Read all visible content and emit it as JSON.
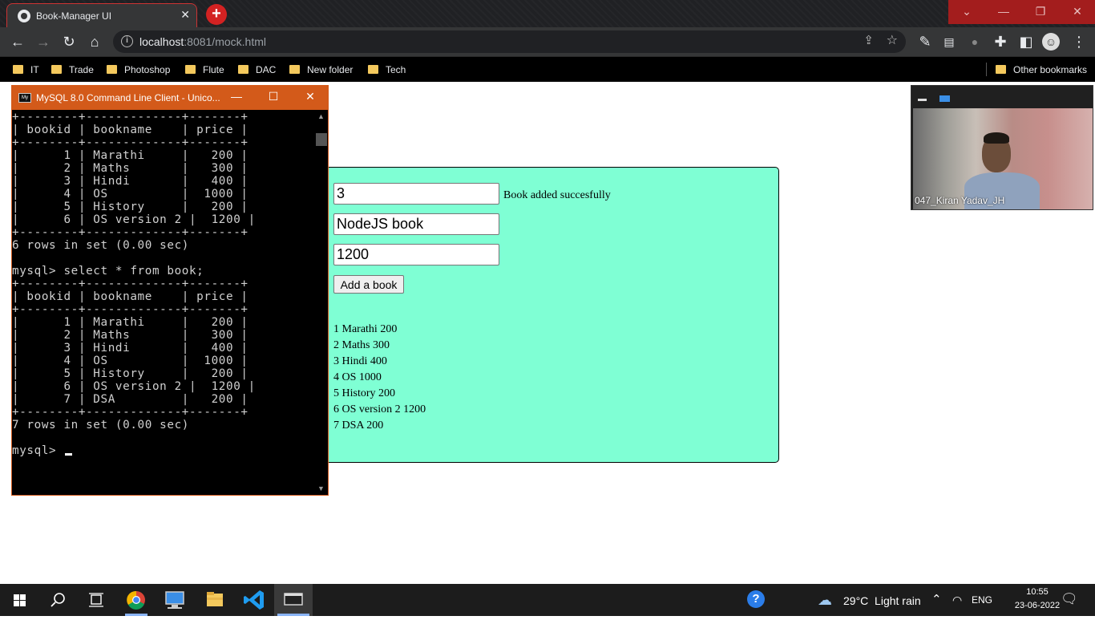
{
  "browser": {
    "tab_title": "Book-Manager UI",
    "url_host": "localhost",
    "url_rest": ":8081/mock.html",
    "bookmarks": [
      "IT",
      "Trade",
      "Photoshop",
      "Flute",
      "DAC",
      "New folder",
      "Tech"
    ],
    "other_bookmarks": "Other bookmarks"
  },
  "app": {
    "id_value": "3",
    "name_value": "NodeJS book",
    "price_value": "1200",
    "status_message": "Book added succesfully",
    "add_button": "Add a book",
    "books": [
      "1 Marathi 200",
      "2 Maths 300",
      "3 Hindi 400",
      "4 OS 1000",
      "5 History 200",
      "6 OS version 2 1200",
      "7 DSA 200"
    ]
  },
  "terminal": {
    "title": "MySQL 8.0 Command Line Client - Unico...",
    "lines": [
      "+--------+-------------+-------+",
      "| bookid | bookname    | price |",
      "+--------+-------------+-------+",
      "|      1 | Marathi     |   200 |",
      "|      2 | Maths       |   300 |",
      "|      3 | Hindi       |   400 |",
      "|      4 | OS          |  1000 |",
      "|      5 | History     |   200 |",
      "|      6 | OS version 2 |  1200 |",
      "+--------+-------------+-------+",
      "6 rows in set (0.00 sec)",
      "",
      "mysql> select * from book;",
      "+--------+-------------+-------+",
      "| bookid | bookname    | price |",
      "+--------+-------------+-------+",
      "|      1 | Marathi     |   200 |",
      "|      2 | Maths       |   300 |",
      "|      3 | Hindi       |   400 |",
      "|      4 | OS          |  1000 |",
      "|      5 | History     |   200 |",
      "|      6 | OS version 2 |  1200 |",
      "|      7 | DSA         |   200 |",
      "+--------+-------------+-------+",
      "7 rows in set (0.00 sec)",
      ""
    ],
    "prompt": "mysql> "
  },
  "video": {
    "participant_name": "047_Kiran Yadav_JH"
  },
  "taskbar": {
    "weather": "29°C  Light rain",
    "language": "ENG",
    "time": "10:55",
    "date": "23-06-2022"
  }
}
